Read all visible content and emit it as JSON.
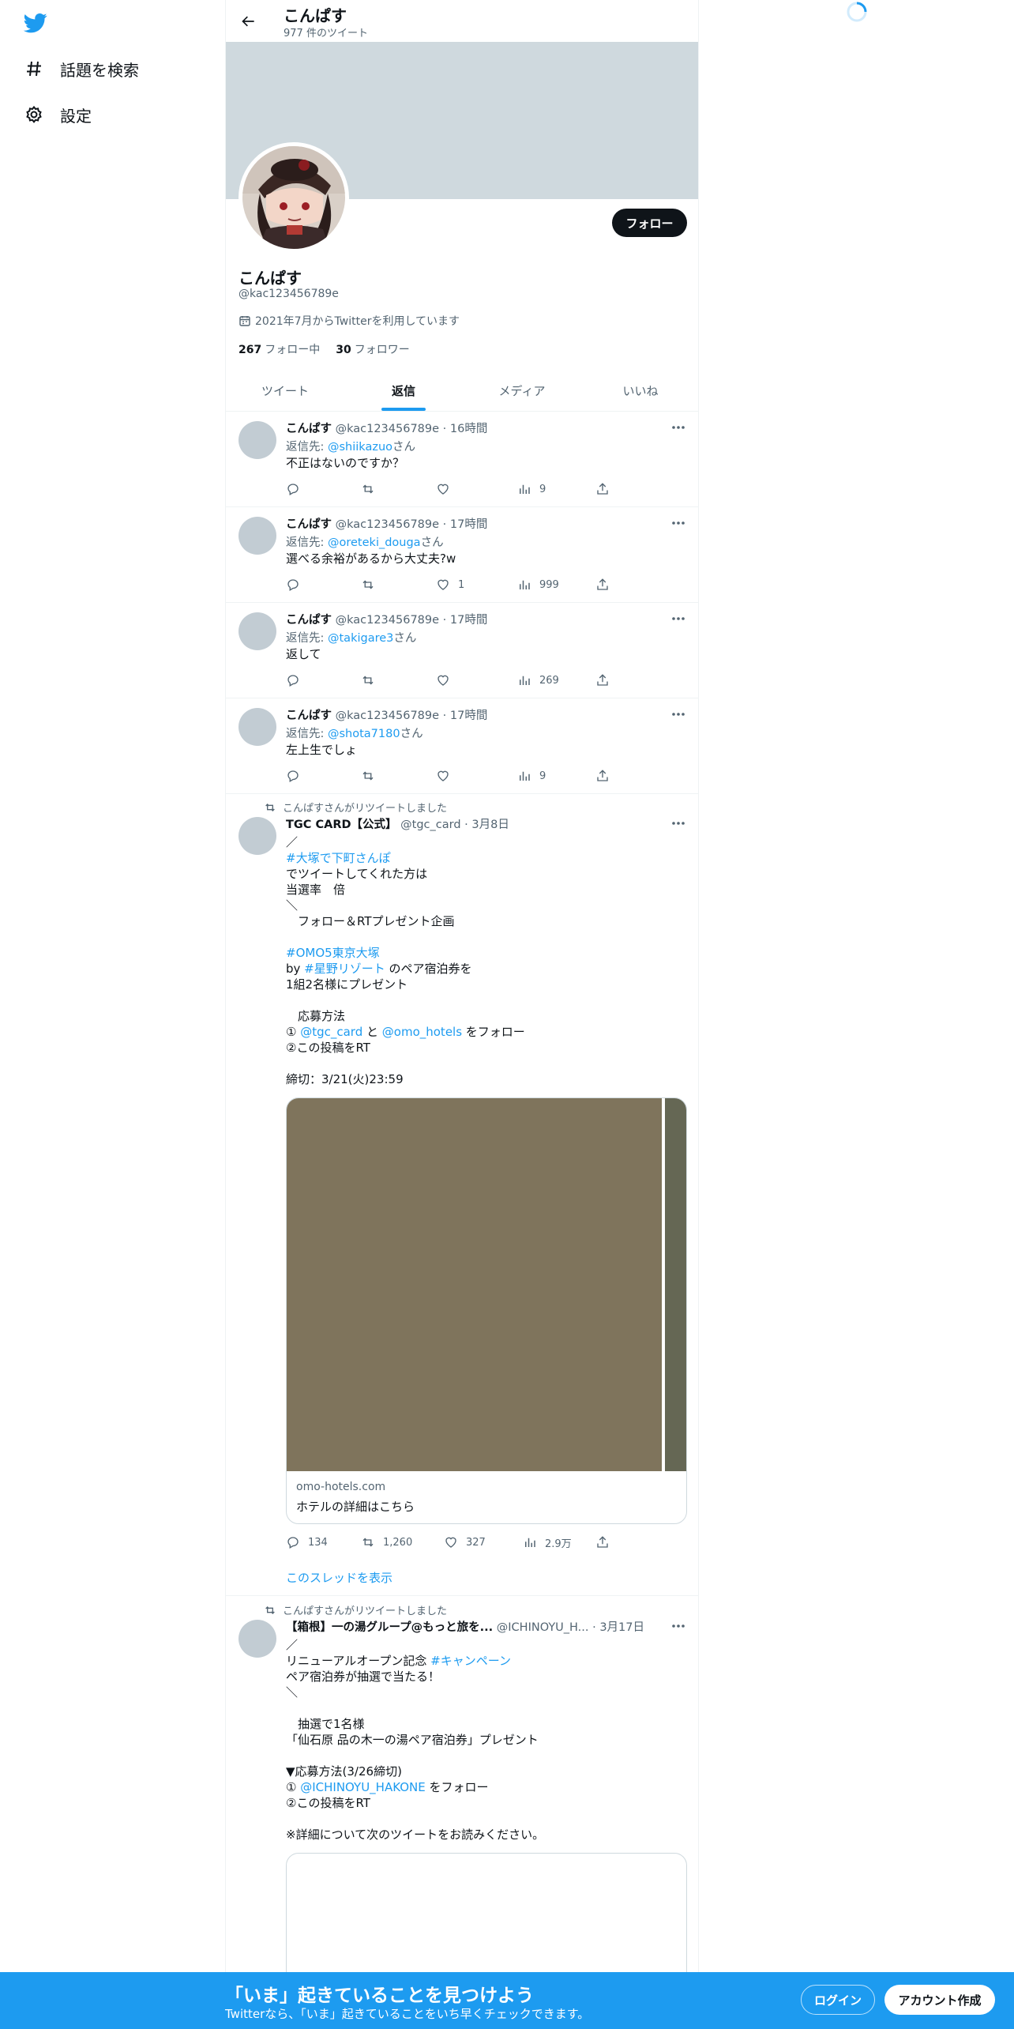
{
  "nav": {
    "items": [
      {
        "label": "話題を検索",
        "icon": "hashtag-icon"
      },
      {
        "label": "設定",
        "icon": "gear-icon"
      }
    ]
  },
  "header": {
    "name": "こんぱす",
    "tweet_count": "977 件のツイート"
  },
  "profile": {
    "name": "こんぱす",
    "handle": "@kac123456789e",
    "joined": "2021年7月からTwitterを利用しています",
    "following_count": "267",
    "following_label": "フォロー中",
    "followers_count": "30",
    "followers_label": "フォロワー",
    "follow_button": "フォロー"
  },
  "tabs": [
    {
      "label": "ツイート",
      "active": false
    },
    {
      "label": "返信",
      "active": true
    },
    {
      "label": "メディア",
      "active": false
    },
    {
      "label": "いいね",
      "active": false
    }
  ],
  "tweets": [
    {
      "name": "こんぱす",
      "meta": "@kac123456789e · 16時間",
      "reply_prefix": "返信先: ",
      "reply_to": "@shiikazuo",
      "reply_suffix": "さん",
      "text": "不正はないのですか？",
      "replies": "",
      "retweets": "",
      "likes": "",
      "views": "9"
    },
    {
      "name": "こんぱす",
      "meta": "@kac123456789e · 17時間",
      "reply_prefix": "返信先: ",
      "reply_to": "@oreteki_douga",
      "reply_suffix": "さん",
      "text": "選べる余裕があるから大丈夫?w",
      "replies": "",
      "retweets": "",
      "likes": "1",
      "views": "999"
    },
    {
      "name": "こんぱす",
      "meta": "@kac123456789e · 17時間",
      "reply_prefix": "返信先: ",
      "reply_to": "@takigare3",
      "reply_suffix": "さん",
      "text": "返して",
      "replies": "",
      "retweets": "",
      "likes": "",
      "views": "269"
    },
    {
      "name": "こんぱす",
      "meta": "@kac123456789e · 17時間",
      "reply_prefix": "返信先: ",
      "reply_to": "@shota7180",
      "reply_suffix": "さん",
      "text": "左上生でしょ",
      "replies": "",
      "retweets": "",
      "likes": "",
      "views": "9"
    }
  ],
  "retweet1": {
    "note": "こんぱすさんがリツイートしました",
    "name": "TGC CARD【公式】",
    "meta": "@tgc_card · 3月8日",
    "lines": {
      "l1": "／",
      "l2": "#大塚で下町さんぽ",
      "l3": "でツイートしてくれた方は",
      "l4": "当選率　倍",
      "l5": "＼",
      "l6": "　フォロー＆RTプレゼント企画",
      "l7": "#OMO5東京大塚",
      "l8a": "by ",
      "l8b": "#星野リゾート",
      "l8c": " のペア宿泊券を",
      "l9": "1組2名様にプレゼント",
      "l10": "　応募方法",
      "l11a": "① ",
      "l11b": "@tgc_card",
      "l11c": " と ",
      "l11d": "@omo_hotels",
      "l11e": " をフォロー",
      "l12": "②この投稿をRT",
      "l13": "締切：3/21(火)23:59"
    },
    "card_domain": "omo-hotels.com",
    "card_title": "ホテルの詳細はこちら",
    "replies": "134",
    "retweets": "1,260",
    "likes": "327",
    "views": "2.9万",
    "thread_link": "このスレッドを表示"
  },
  "retweet2": {
    "note": "こんぱすさんがリツイートしました",
    "name": "【箱根】一の湯グループ@もっと旅を...",
    "meta": "@ICHINOYU_H... · 3月17日",
    "lines": {
      "l1": "／",
      "l2a": "リニューアルオープン記念 ",
      "l2b": "#キャンペーン",
      "l3": "ペア宿泊券が抽選で当たる！",
      "l4": "＼",
      "l5": "　抽選で1名様",
      "l6": "「仙石原 品の木一の湯ペア宿泊券」プレゼント",
      "l7": "▼応募方法(3/26締切)",
      "l8a": "① ",
      "l8b": "@ICHINOYU_HAKONE",
      "l8c": " をフォロー",
      "l9": "②この投稿をRT",
      "l10": "※詳細について次のツイートをお読みください。"
    }
  },
  "bottom_bar": {
    "title": "「いま」起きていることを見つけよう",
    "subtitle": "Twitterなら、「いま」起きていることをいち早くチェックできます。",
    "login": "ログイン",
    "signup": "アカウント作成"
  },
  "colors": {
    "accent": "#1d9bf0",
    "text": "#0f1419",
    "secondary": "#536471",
    "banner": "#cfd9de"
  }
}
